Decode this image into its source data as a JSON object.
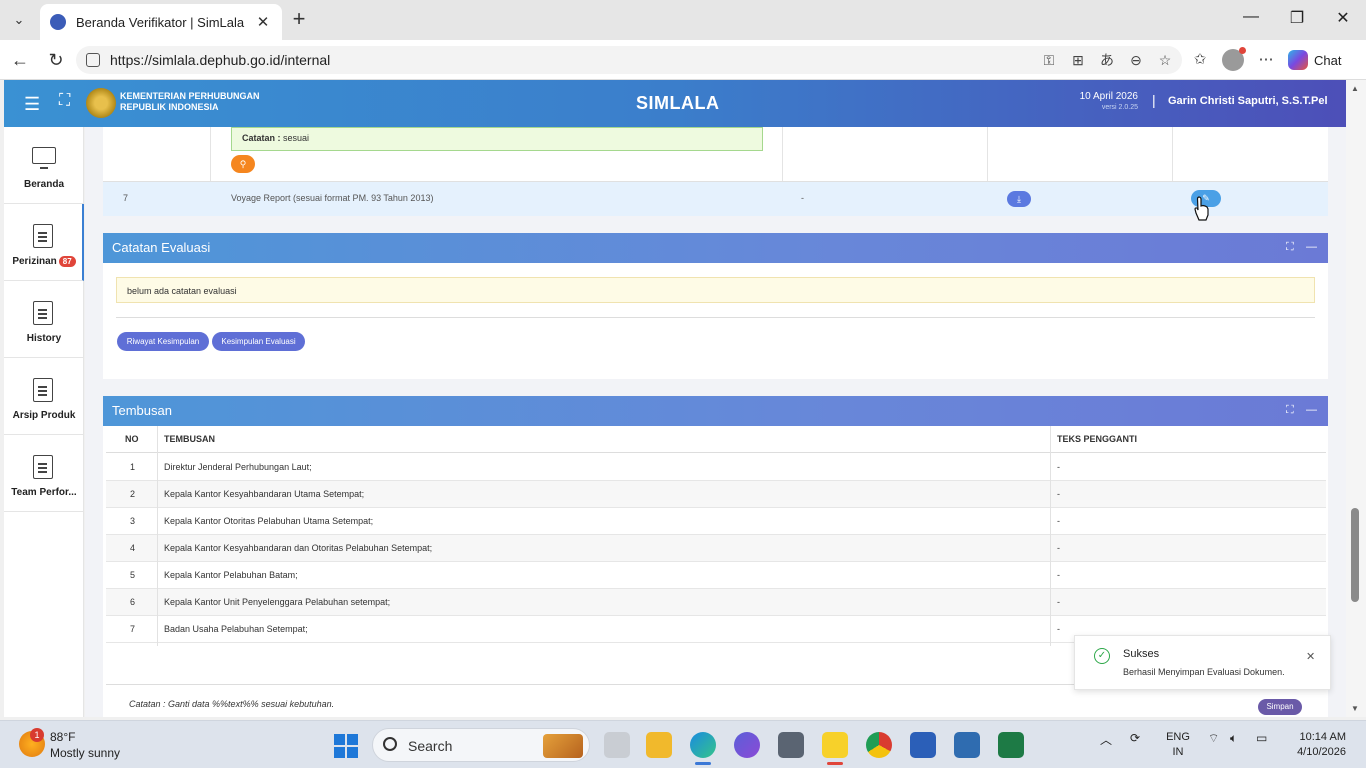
{
  "browser": {
    "tab_title": "Beranda Verifikator | SimLala",
    "url": "https://simlala.dephub.go.id/internal",
    "chat_label": "Chat"
  },
  "header": {
    "ministry_line1": "KEMENTERIAN PERHUBUNGAN",
    "ministry_line2": "REPUBLIK INDONESIA",
    "app_title": "SIMLALA",
    "date": "10 April 2026",
    "version": "versi 2.0.25",
    "separator": "|",
    "user": "Garin Christi Saputri, S.S.T.Pel"
  },
  "sidebar": {
    "items": [
      {
        "label": "Beranda"
      },
      {
        "label": "Perizinan",
        "badge": "87"
      },
      {
        "label": "History"
      },
      {
        "label": "Arsip Produk"
      },
      {
        "label": "Team Perfor..."
      }
    ]
  },
  "doc_table": {
    "note_label": "Catatan :",
    "note_value": "sesuai",
    "row7": {
      "no": "7",
      "name": "Voyage Report (sesuai format PM. 93 Tahun 2013)",
      "value": "-"
    }
  },
  "evaluasi": {
    "title": "Catatan Evaluasi",
    "message": "belum ada catatan evaluasi",
    "btn_riwayat": "Riwayat Kesimpulan",
    "btn_kesimpulan": "Kesimpulan Evaluasi"
  },
  "tembusan": {
    "title": "Tembusan",
    "columns": {
      "no": "NO",
      "tembusan": "TEMBUSAN",
      "teks": "TEKS PENGGANTI"
    },
    "rows": [
      {
        "no": "1",
        "name": "Direktur Jenderal Perhubungan Laut;",
        "teks": "-"
      },
      {
        "no": "2",
        "name": "Kepala Kantor Kesyahbandaran Utama Setempat;",
        "teks": "-"
      },
      {
        "no": "3",
        "name": "Kepala Kantor Otoritas Pelabuhan Utama Setempat;",
        "teks": "-"
      },
      {
        "no": "4",
        "name": "Kepala Kantor Kesyahbandaran dan Otoritas Pelabuhan Setempat;",
        "teks": "-"
      },
      {
        "no": "5",
        "name": "Kepala Kantor Pelabuhan Batam;",
        "teks": "-"
      },
      {
        "no": "6",
        "name": "Kepala Kantor Unit Penyelenggara Pelabuhan setempat;",
        "teks": "-"
      },
      {
        "no": "7",
        "name": "Badan Usaha Pelabuhan Setempat;",
        "teks": "-"
      }
    ],
    "note": "Catatan : Ganti data %%text%% sesuai kebutuhan.",
    "save_label": "Simpan"
  },
  "toast": {
    "title": "Sukses",
    "message": "Berhasil Menyimpan Evaluasi Dokumen."
  },
  "taskbar": {
    "weather_temp": "88°F",
    "weather_desc": "Mostly sunny",
    "weather_badge": "1",
    "search_placeholder": "Search",
    "lang1": "ENG",
    "lang2": "IN",
    "time": "10:14 AM",
    "date": "4/10/2026"
  },
  "colors": {
    "header_start": "#3a91d3",
    "header_end": "#4d4fb8",
    "toast_success": "#2ea84a",
    "badge": "#e0453a"
  }
}
